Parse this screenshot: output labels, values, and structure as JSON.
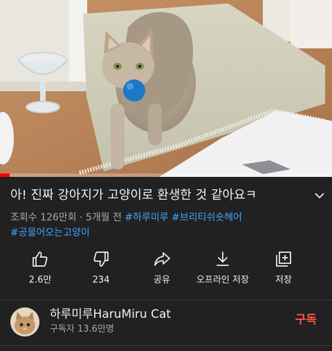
{
  "video": {
    "thumbnail_description": "tabby cat carrying blue ball",
    "progress_fraction": 0.03
  },
  "title": "아! 진짜 강아지가 고양이로 환생한 것 같아요ㅋ",
  "meta": {
    "views": "조회수 126만회",
    "separator": "·",
    "age": "5개월 전",
    "hashtags": [
      "#하루미루",
      "#브리티쉬숏헤어",
      "#공물어오는고양이"
    ]
  },
  "actions": [
    {
      "icon": "thumb-up-icon",
      "label": "2.6만"
    },
    {
      "icon": "thumb-down-icon",
      "label": "234"
    },
    {
      "icon": "share-icon",
      "label": "공유"
    },
    {
      "icon": "download-icon",
      "label": "오프라인 저장"
    },
    {
      "icon": "save-to-playlist-icon",
      "label": "저장"
    }
  ],
  "channel": {
    "name": "하루미루HaruMiru Cat",
    "subscribers": "구독자 13.6만명",
    "subscribe_label": "구독",
    "subscribe_color": "#ff4e45"
  },
  "colors": {
    "background": "#212121",
    "hashtag": "#3ea6ff",
    "progress": "#ff0000"
  }
}
